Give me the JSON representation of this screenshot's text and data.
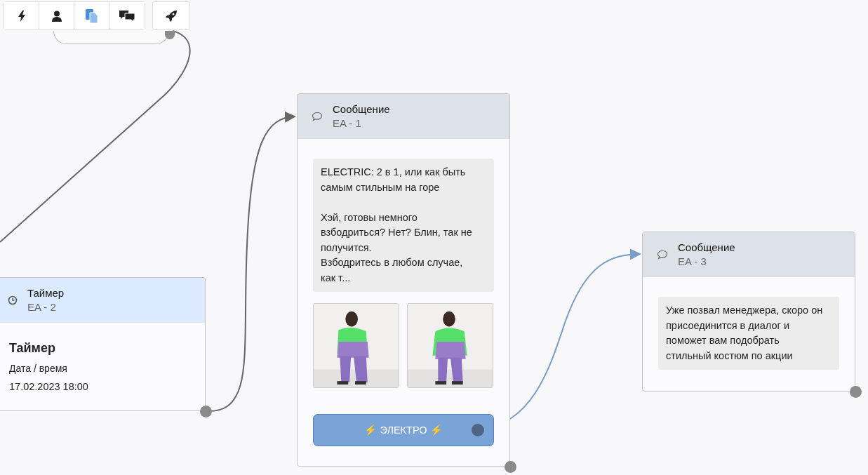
{
  "toolbar": [
    {
      "selected": false
    },
    {
      "selected": false
    },
    {
      "selected": true
    },
    {
      "selected": false
    }
  ],
  "nodes": [
    {
      "kind": "timer",
      "title": "Таймер",
      "subtitle": "EA - 2",
      "heading": "Таймер",
      "field_label": "Дата / время",
      "field_value": "17.02.2023 18:00"
    },
    {
      "kind": "message",
      "title": "Сообщение",
      "subtitle": "EA - 1",
      "text": "ELECTRIC: 2 в 1, или как быть самым стильным на горе\n\nХэй, готовы немного взбодриться? Нет? Блин, так не получится.\nВзбодритесь в любом случае, как т...",
      "images": [
        {
          "kind": "picture"
        },
        {
          "kind": "picture"
        }
      ],
      "buttons": [
        {
          "label": "⚡ ЭЛЕКТРО ⚡"
        }
      ]
    },
    {
      "kind": "message",
      "title": "Сообщение",
      "subtitle": "EA - 3",
      "text": "Уже позвал менеджера, скоро он присоединится в диалог и поможет вам подобрать стильный костюм по акции"
    }
  ]
}
